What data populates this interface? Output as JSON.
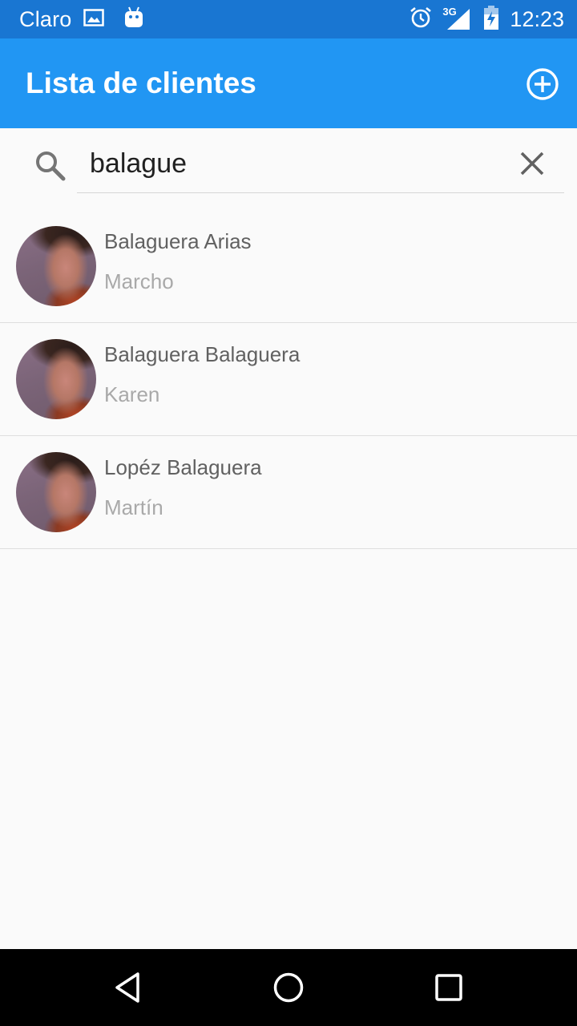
{
  "status_bar": {
    "carrier": "Claro",
    "time": "12:23",
    "network_type": "3G",
    "icons": [
      "image-notification-icon",
      "android-debug-icon",
      "alarm-icon",
      "signal-icon",
      "battery-charging-icon"
    ],
    "background_color": "#1976d2"
  },
  "app_bar": {
    "title": "Lista de clientes",
    "background_color": "#2196f3",
    "action_icon": "add-circle-icon"
  },
  "search": {
    "value": "balague",
    "search_icon": "search-icon",
    "clear_icon": "close-icon"
  },
  "clients": [
    {
      "last_name": "Balaguera Arias",
      "first_name": "Marcho"
    },
    {
      "last_name": "Balaguera Balaguera",
      "first_name": "Karen"
    },
    {
      "last_name": "Lopéz Balaguera",
      "first_name": "Martín"
    }
  ],
  "nav_bar": {
    "icons": [
      "back-icon",
      "home-icon",
      "recents-icon"
    ]
  }
}
